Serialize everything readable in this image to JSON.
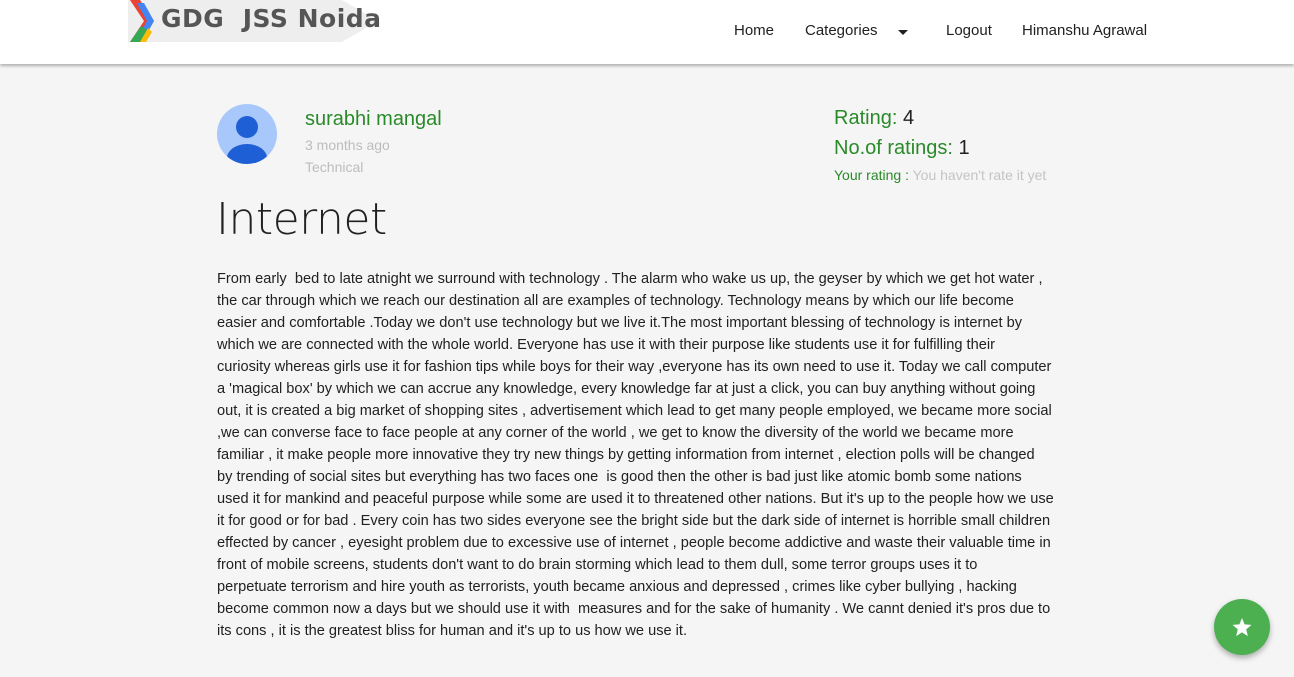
{
  "navbar": {
    "logo_text": "GDG  JSS Noida",
    "links": {
      "home": "Home",
      "categories": "Categories",
      "logout": "Logout",
      "user": "Himanshu Agrawal"
    }
  },
  "post": {
    "author": "surabhi mangal",
    "posted": "3 months ago",
    "category": "Technical",
    "rating_label": "Rating:",
    "rating_value": "4",
    "num_ratings_label": "No.of ratings:",
    "num_ratings_value": "1",
    "your_rating_label": "Your rating :",
    "your_rating_value": "You haven't rate it yet",
    "title": "Internet",
    "body_lines": [
      "From early  bed to late atnight we surround with technology . The alarm who wake us up, the geyser by which we get hot water ,",
      "the car through which we reach our destination all are examples of technology. Technology means by which our life become",
      "easier and comfortable .Today we don't use technology but we live it.The most important blessing of technology is internet by",
      "which we are connected with the whole world. Everyone has use it with their purpose like students use it for fulfilling their",
      "curiosity whereas girls use it for fashion tips while boys for their way ,everyone has its own need to use it. Today we call computer",
      "a 'magical box' by which we can accrue any knowledge, every knowledge far at just a click, you can buy anything without going",
      "out, it is created a big market of shopping sites , advertisement which lead to get many people employed, we became more social",
      ",we can converse face to face people at any corner of the world , we get to know the diversity of the world we became more",
      "familiar , it make people more innovative they try new things by getting information from internet , election polls will be changed",
      "by trending of social sites but everything has two faces one  is good then the other is bad just like atomic bomb some nations",
      "used it for mankind and peaceful purpose while some are used it to threatened other nations. But it's up to the people how we use",
      "it for good or for bad . Every coin has two sides everyone see the bright side but the dark side of internet is horrible small children",
      "effected by cancer , eyesight problem due to excessive use of internet , people become addictive and waste their valuable time in",
      "front of mobile screens, students don't want to do brain storming which lead to them dull, some terror groups uses it to",
      "perpetuate terrorism and hire youth as terrorists, youth became anxious and depressed , crimes like cyber bullying , hacking",
      "become common now a days but we should use it with  measures and for the sake of humanity . We cannt denied it's pros due to",
      "its cons , it is the greatest bliss for human and it's up to us how we use it."
    ]
  },
  "icons": {
    "fab": "star-icon",
    "categories_dropdown": "caret-down-icon",
    "avatar": "person-icon"
  },
  "colors": {
    "accent_green": "#2a8a2a",
    "fab_green": "#4caf50",
    "muted": "#bdbdbd"
  }
}
